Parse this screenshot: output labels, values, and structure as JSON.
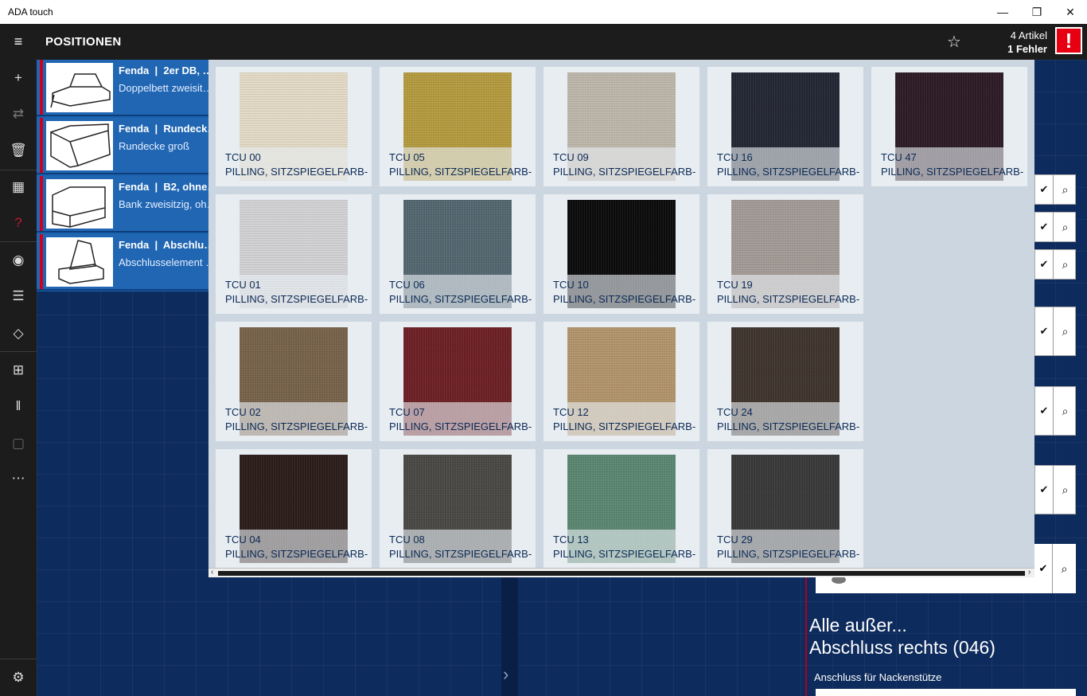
{
  "window": {
    "title": "ADA touch",
    "minimize": "—",
    "restore": "❐",
    "close": "✕"
  },
  "header": {
    "menu_glyph": "≡",
    "title": "POSITIONEN",
    "star_glyph": "☆",
    "article_count": "4 Artikel",
    "error_count": "1 Fehler",
    "alert_glyph": "!"
  },
  "rail": [
    {
      "name": "add-icon",
      "glyph": "+"
    },
    {
      "name": "swap-icon",
      "glyph": "⇄"
    },
    {
      "name": "delete-icon",
      "glyph": "🗑"
    },
    {
      "name": "table-icon",
      "glyph": "▦"
    },
    {
      "name": "help-icon",
      "glyph": "?"
    },
    {
      "name": "eye-icon",
      "glyph": "◉"
    },
    {
      "name": "user-list-icon",
      "glyph": "☰"
    },
    {
      "name": "tag-icon",
      "glyph": "◇"
    },
    {
      "name": "add-note-icon",
      "glyph": "⊞"
    },
    {
      "name": "pause-icon",
      "glyph": "‖"
    },
    {
      "name": "bag-icon",
      "glyph": "▢"
    },
    {
      "name": "more-icon",
      "glyph": "⋯"
    },
    {
      "name": "settings-icon",
      "glyph": "⚙"
    }
  ],
  "positions": [
    {
      "brand": "Fenda",
      "sep": "|",
      "model": "2er DB, …",
      "desc": "Doppelbett zweisit…"
    },
    {
      "brand": "Fenda",
      "sep": "|",
      "model": "Rundeck…",
      "desc": "Rundecke groß"
    },
    {
      "brand": "Fenda",
      "sep": "|",
      "model": "B2, ohne…",
      "desc": "Bank zweisitzig, oh…"
    },
    {
      "brand": "Fenda",
      "sep": "|",
      "model": "Abschlu…",
      "desc": "Abschlusselement …"
    }
  ],
  "fabrics": [
    {
      "code": "TCU 00",
      "desc": "PILLING, SITZSPIEGELFARB-",
      "color": "#e3dac6"
    },
    {
      "code": "TCU 05",
      "desc": "PILLING, SITZSPIEGELFARB-",
      "color": "#b49a3e"
    },
    {
      "code": "TCU 09",
      "desc": "PILLING, SITZSPIEGELFARB-",
      "color": "#bdb6aa"
    },
    {
      "code": "TCU 16",
      "desc": "PILLING, SITZSPIEGELFARB-",
      "color": "#232633"
    },
    {
      "code": "TCU 47",
      "desc": "PILLING, SITZSPIEGELFARB-",
      "color": "#2c1a24"
    },
    {
      "code": "TCU 01",
      "desc": "PILLING, SITZSPIEGELFARB-",
      "color": "#d2d2d4"
    },
    {
      "code": "TCU 06",
      "desc": "PILLING, SITZSPIEGELFARB-",
      "color": "#53666f"
    },
    {
      "code": "TCU 10",
      "desc": "PILLING, SITZSPIEGELFARB-",
      "color": "#0b0b0c"
    },
    {
      "code": "TCU 19",
      "desc": "PILLING, SITZSPIEGELFARB-",
      "color": "#a29a95"
    },
    {
      "code": "TCU 02",
      "desc": "PILLING, SITZSPIEGELFARB-",
      "color": "#77624a"
    },
    {
      "code": "TCU 07",
      "desc": "PILLING, SITZSPIEGELFARB-",
      "color": "#6c1f24"
    },
    {
      "code": "TCU 12",
      "desc": "PILLING, SITZSPIEGELFARB-",
      "color": "#b1946b"
    },
    {
      "code": "TCU 24",
      "desc": "PILLING, SITZSPIEGELFARB-",
      "color": "#3e342c"
    },
    {
      "code": "TCU 04",
      "desc": "PILLING, SITZSPIEGELFARB-",
      "color": "#2a1c19"
    },
    {
      "code": "TCU 08",
      "desc": "PILLING, SITZSPIEGELFARB-",
      "color": "#494844"
    },
    {
      "code": "TCU 13",
      "desc": "PILLING, SITZSPIEGELFARB-",
      "color": "#5a8670"
    },
    {
      "code": "TCU 29",
      "desc": "PILLING, SITZSPIEGELFARB-",
      "color": "#393839"
    }
  ],
  "right_panel": {
    "check_glyph": "✔",
    "search_glyph": "⌕",
    "headline_1": "Alle außer...",
    "headline_2": "Abschluss rechts (046)",
    "label": "Anschluss für Nackenstütze"
  },
  "canvas": {
    "chevron": "›"
  },
  "scroll": {
    "left": "‹",
    "right": "›"
  },
  "colors": {
    "accent_blue": "#1a63b0",
    "error_red": "#e60012",
    "canvas_blue": "#0d2b5c"
  }
}
